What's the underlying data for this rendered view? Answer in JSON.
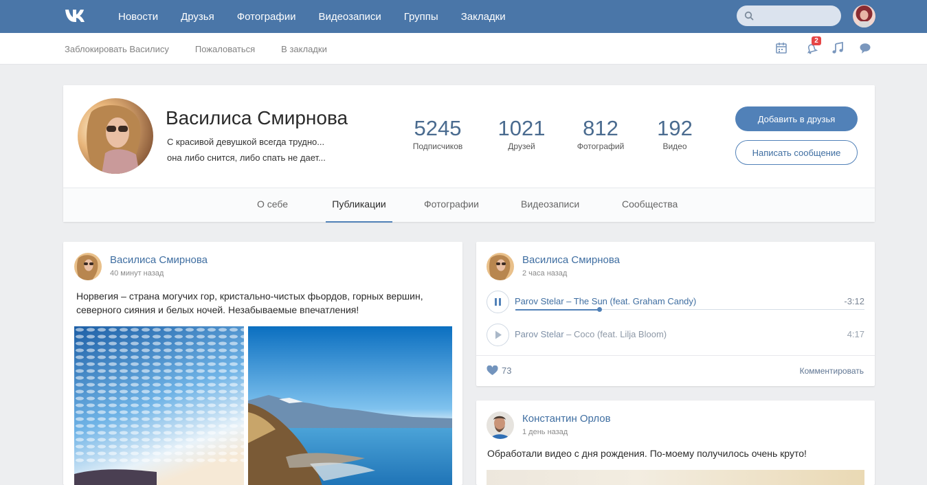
{
  "nav": {
    "items": [
      "Новости",
      "Друзья",
      "Фотографии",
      "Видеозаписи",
      "Группы",
      "Закладки"
    ],
    "search_placeholder": ""
  },
  "subbar": {
    "links": [
      "Заблокировать Василису",
      "Пожаловаться",
      "В закладки"
    ],
    "notification_count": "2",
    "icons": [
      "calendar-icon",
      "notifications-icon",
      "music-icon",
      "messages-icon"
    ]
  },
  "profile": {
    "name": "Василиса Смирнова",
    "status_line1": "С красивой девушкой всегда трудно...",
    "status_line2": "она либо снится, либо спать не дает...",
    "stats": [
      {
        "num": "5245",
        "label": "Подписчиков"
      },
      {
        "num": "1021",
        "label": "Друзей"
      },
      {
        "num": "812",
        "label": "Фотографий"
      },
      {
        "num": "192",
        "label": "Видео"
      }
    ],
    "add_friend": "Добавить в друзья",
    "send_message": "Написать сообщение",
    "tabs": [
      "О себе",
      "Публикации",
      "Фотографии",
      "Видеозаписи",
      "Сообщества"
    ],
    "active_tab": "Публикации"
  },
  "posts": {
    "norway": {
      "author": "Василиса Смирнова",
      "time": "40 минут назад",
      "text_line1": "Норвегия – страна могучих гор, кристально-чистых фьордов, горных вершин,",
      "text_line2": "северного сияния и белых ночей. Незабываемые впечатления!"
    },
    "music": {
      "author": "Василиса Смирнова",
      "time": "2 часа назад",
      "tracks": [
        {
          "artist": "Parov Stelar",
          "title": " – The Sun (feat. Graham Candy)",
          "duration": "-3:12",
          "playing": true,
          "progress": 0.24
        },
        {
          "artist": "Parov Stelar",
          "title": " – Coco (feat. Lilja Bloom)",
          "duration": "4:17",
          "playing": false
        }
      ],
      "likes": "73",
      "comment": "Комментировать"
    },
    "video": {
      "author": "Константин Орлов",
      "time": "1 день назад",
      "text": "Обработали видео с дня рождения. По-моему получилось очень круто!"
    }
  },
  "colors": {
    "header": "#4a76a8",
    "accent": "#5181b8",
    "link": "#3f6ea1",
    "stat_number": "#4a6b8f"
  }
}
